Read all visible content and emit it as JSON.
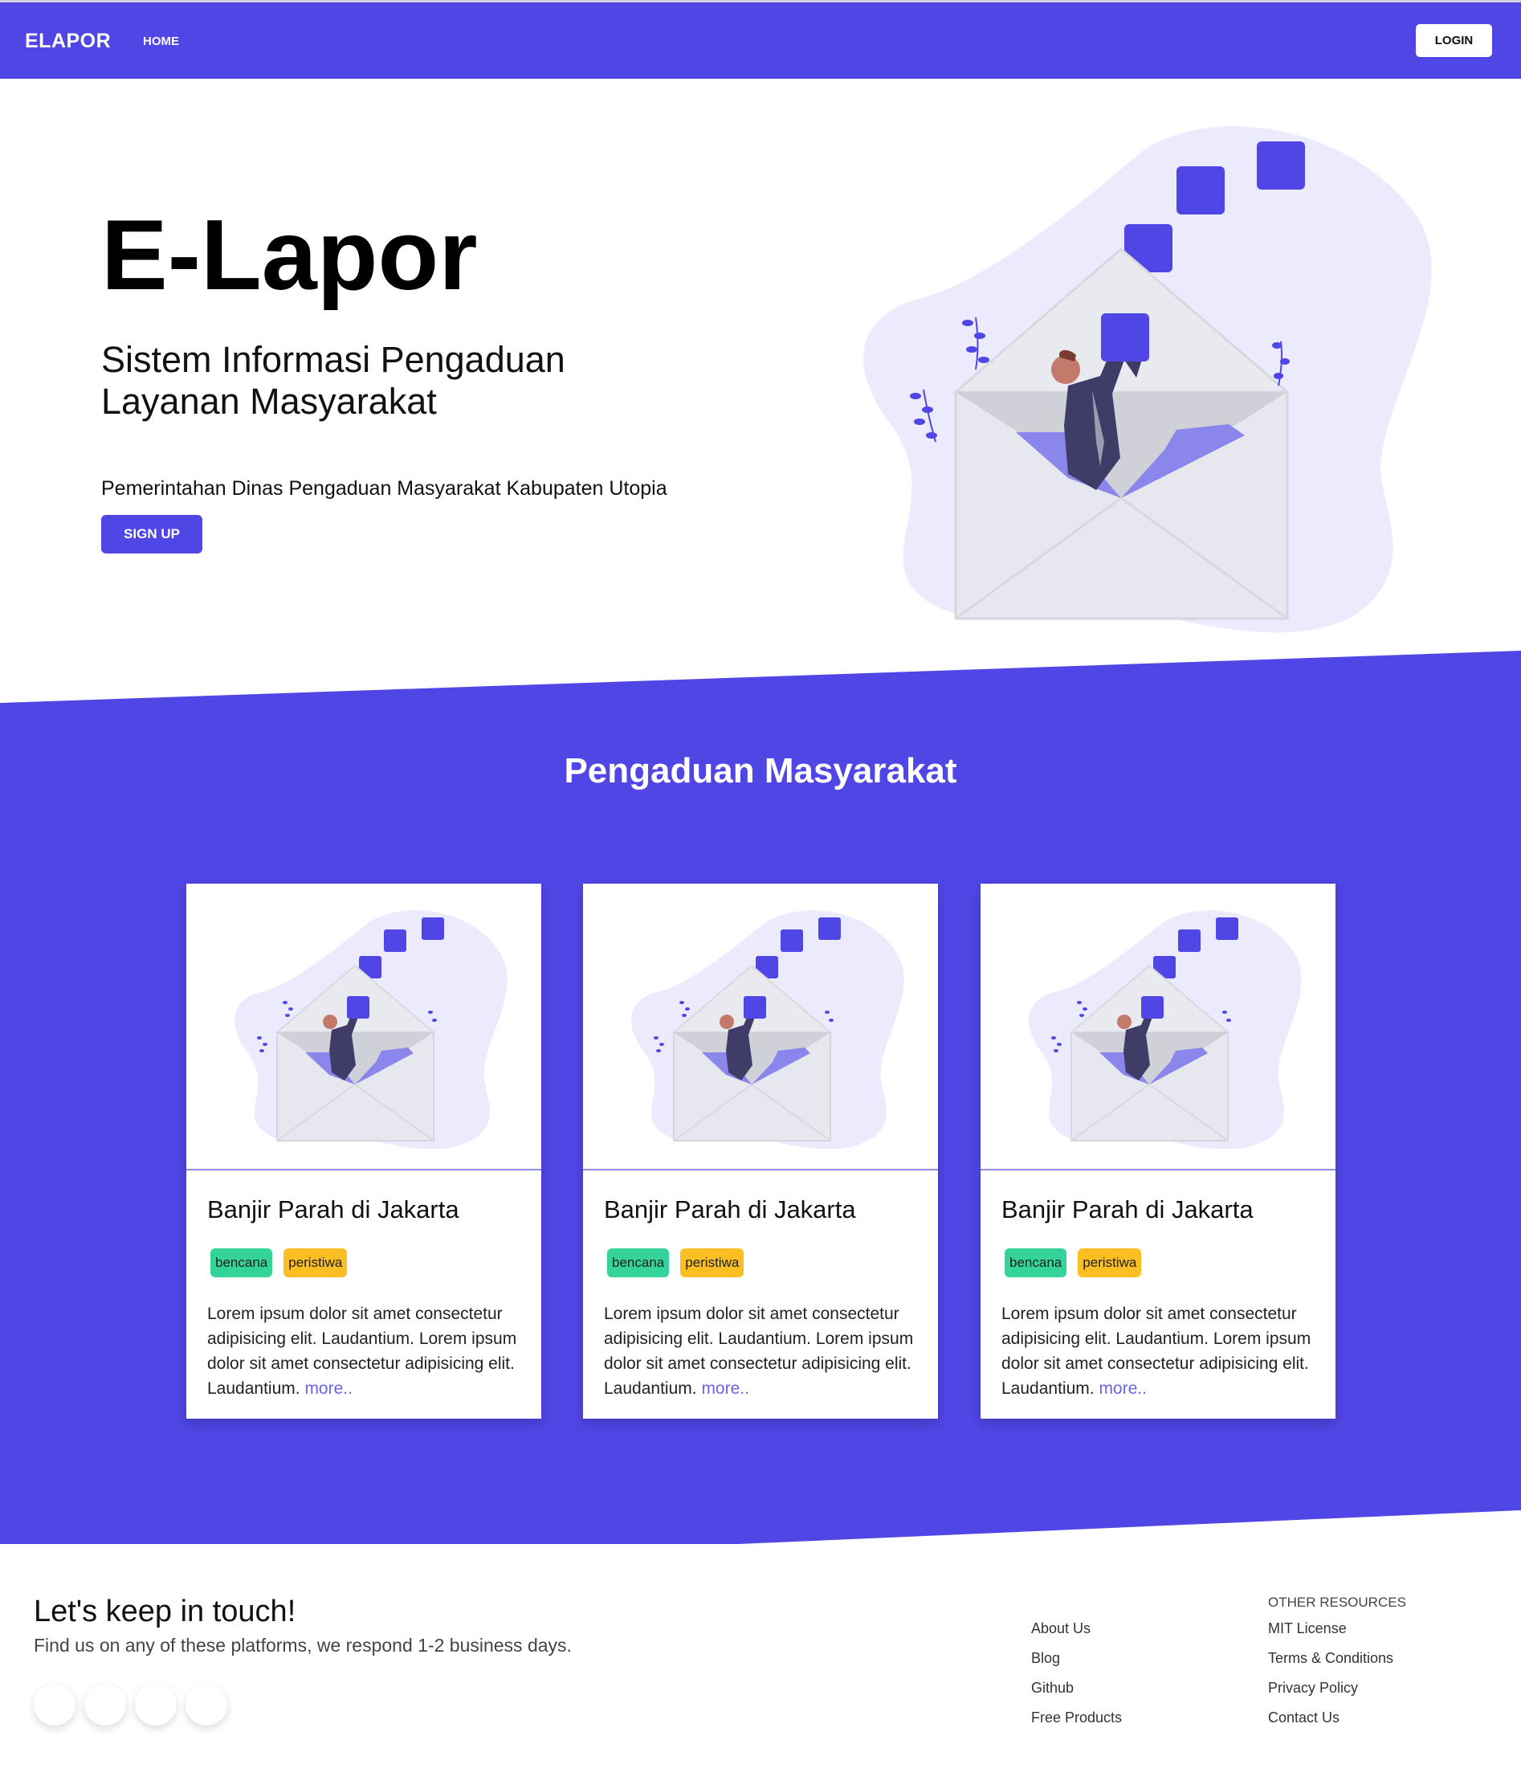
{
  "nav": {
    "brand": "ELAPOR",
    "home": "HOME",
    "login": "LOGIN"
  },
  "hero": {
    "title": "E-Lapor",
    "subtitle": "Sistem Informasi Pengaduan Layanan Masyarakat",
    "description": "Pemerintahan Dinas Pengaduan Masyarakat Kabupaten Utopia",
    "signup": "SIGN UP",
    "illustration": "envelope-man-illustration"
  },
  "section": {
    "title": "Pengaduan Masyarakat"
  },
  "cards": [
    {
      "title": "Banjir Parah di Jakarta",
      "tags": [
        "bencana",
        "peristiwa"
      ],
      "text": "Lorem ipsum dolor sit amet consectetur adipisicing elit. Laudantium. Lorem ipsum dolor sit amet consectetur adipisicing elit. Laudantium.",
      "more": "more.."
    },
    {
      "title": "Banjir Parah di Jakarta",
      "tags": [
        "bencana",
        "peristiwa"
      ],
      "text": "Lorem ipsum dolor sit amet consectetur adipisicing elit. Laudantium. Lorem ipsum dolor sit amet consectetur adipisicing elit. Laudantium.",
      "more": "more.."
    },
    {
      "title": "Banjir Parah di Jakarta",
      "tags": [
        "bencana",
        "peristiwa"
      ],
      "text": "Lorem ipsum dolor sit amet consectetur adipisicing elit. Laudantium. Lorem ipsum dolor sit amet consectetur adipisicing elit. Laudantium.",
      "more": "more.."
    }
  ],
  "footer": {
    "title": "Let's keep in touch!",
    "subtitle": "Find us on any of these platforms, we respond 1-2 business days.",
    "links": [
      "About Us",
      "Blog",
      "Github",
      "Free Products"
    ],
    "other_heading": "OTHER RESOURCES",
    "other_links": [
      "MIT License",
      "Terms & Conditions",
      "Privacy Policy",
      "Contact Us"
    ]
  },
  "colors": {
    "primary": "#4f46e5",
    "tag_green": "#34d399",
    "tag_yellow": "#fbbf24",
    "link": "#6b63e8"
  }
}
